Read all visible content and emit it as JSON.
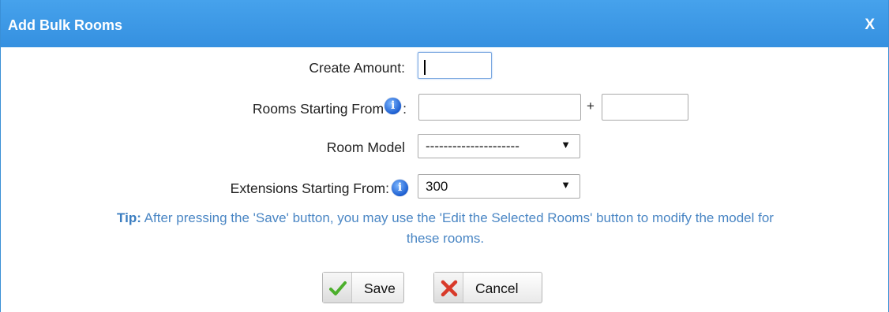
{
  "dialog": {
    "title": "Add Bulk Rooms",
    "close_label": "X"
  },
  "form": {
    "create_amount": {
      "label": "Create Amount:",
      "value": ""
    },
    "rooms_starting_from": {
      "label": "Rooms Starting From",
      "label_suffix": ":",
      "value_prefix": "",
      "separator": "+",
      "value_suffix": ""
    },
    "room_model": {
      "label": "Room Model",
      "selected": "---------------------"
    },
    "extensions_starting_from": {
      "label": "Extensions Starting From:",
      "selected": "300"
    },
    "info_icon_glyph": "i"
  },
  "tip": {
    "prefix": "Tip:",
    "line1": " After pressing the 'Save' button, you may use the 'Edit the Selected Rooms' button to modify the model for",
    "line2": "these rooms."
  },
  "buttons": {
    "save_label": "Save",
    "cancel_label": "Cancel"
  },
  "colors": {
    "titlebar": "#3a98e6",
    "tip_text": "#4a86c4",
    "save_icon": "#4caf2c",
    "cancel_icon": "#d83a2a"
  }
}
